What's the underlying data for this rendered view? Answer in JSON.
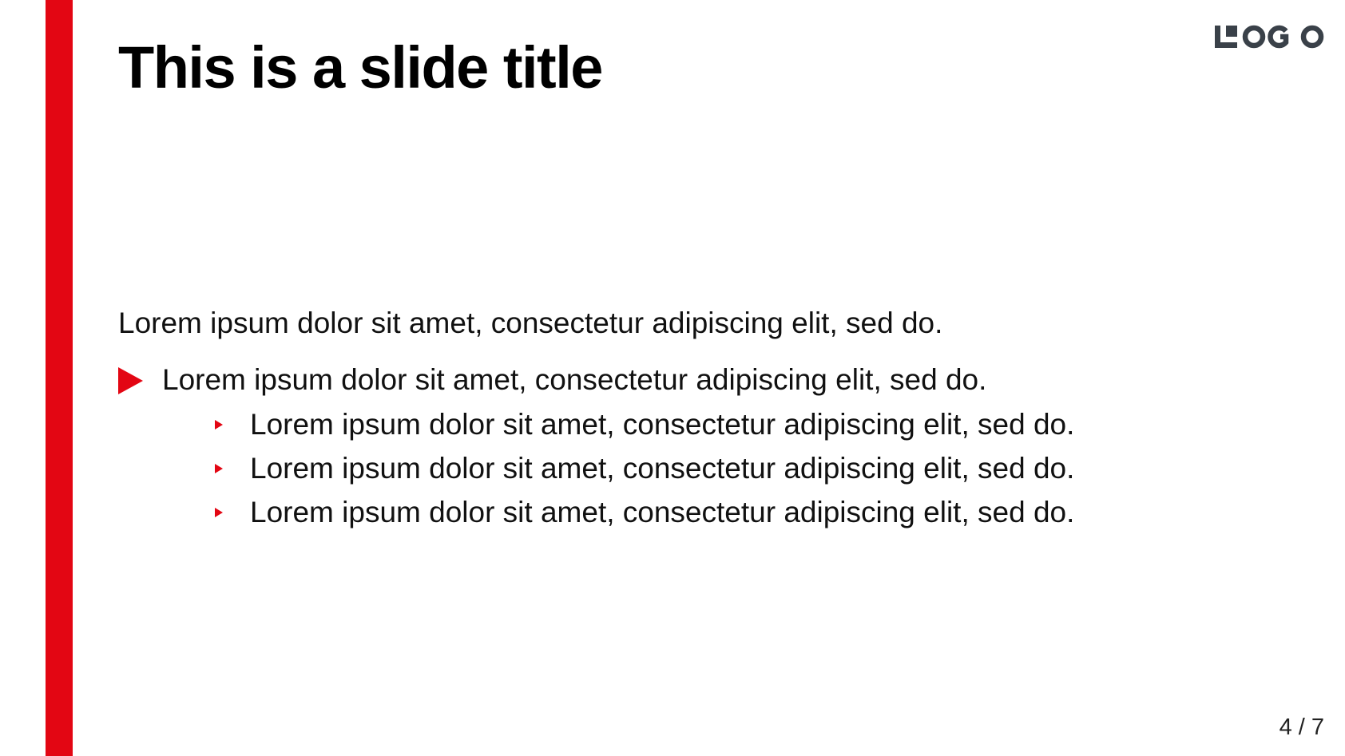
{
  "slide": {
    "title": "This is a slide title",
    "logo_text": "LOGO",
    "accent_color": "#e30613",
    "logo_color": "#3a4149",
    "paragraph": "Lorem ipsum dolor sit amet, consectetur adipiscing elit, sed do.",
    "bullet": {
      "text": "Lorem ipsum dolor sit amet, consectetur adipiscing elit, sed do.",
      "icon": "triangle-right-icon",
      "sub_items": [
        {
          "text": "Lorem ipsum dolor sit amet, consectetur adipiscing elit, sed do.",
          "icon": "small-triangle-right-icon"
        },
        {
          "text": "Lorem ipsum dolor sit amet, consectetur adipiscing elit, sed do.",
          "icon": "small-triangle-right-icon"
        },
        {
          "text": "Lorem ipsum dolor sit amet, consectetur adipiscing elit, sed do.",
          "icon": "small-triangle-right-icon"
        }
      ]
    },
    "page_number": "4 / 7"
  }
}
